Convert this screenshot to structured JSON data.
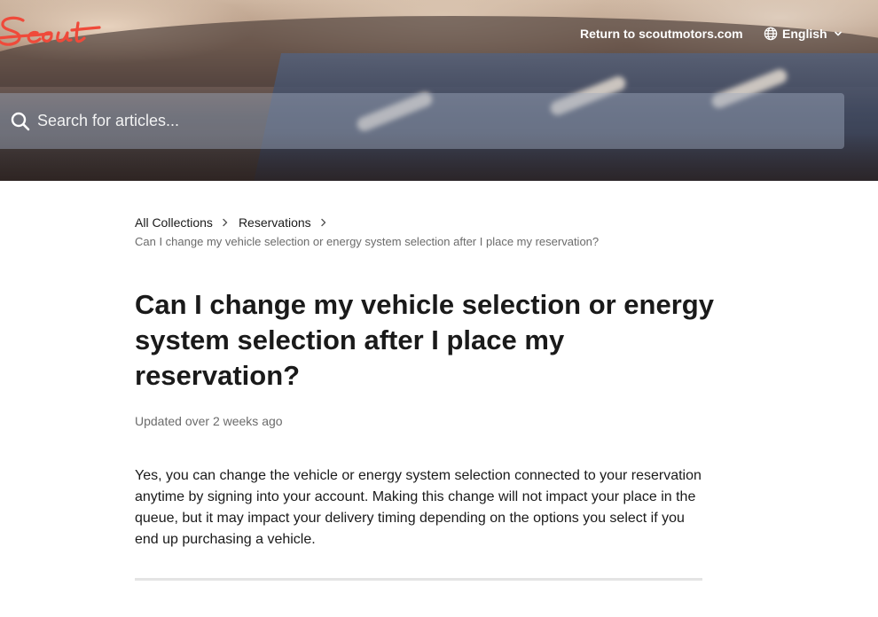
{
  "header": {
    "logo_text": "Scout",
    "return_link": "Return to scoutmotors.com",
    "language": "English"
  },
  "search": {
    "placeholder": "Search for articles..."
  },
  "breadcrumb": {
    "items": [
      "All Collections",
      "Reservations"
    ],
    "current": "Can I change my vehicle selection or energy system selection after I place my reservation?"
  },
  "article": {
    "title": "Can I change my vehicle selection or energy system selection after I place my reservation?",
    "updated": "Updated over 2 weeks ago",
    "body": "Yes, you can change the vehicle or energy system selection connected to your reservation anytime by signing into your account. Making this change will not impact your place in the queue, but it may impact your delivery timing depending on the options you select if you end up purchasing a vehicle."
  },
  "colors": {
    "brand": "#ef4a3a",
    "text": "#1a1a1a",
    "muted": "#6b6b6b"
  },
  "icons": [
    "search-icon",
    "globe-icon",
    "chevron-down-icon",
    "chevron-right-icon"
  ]
}
